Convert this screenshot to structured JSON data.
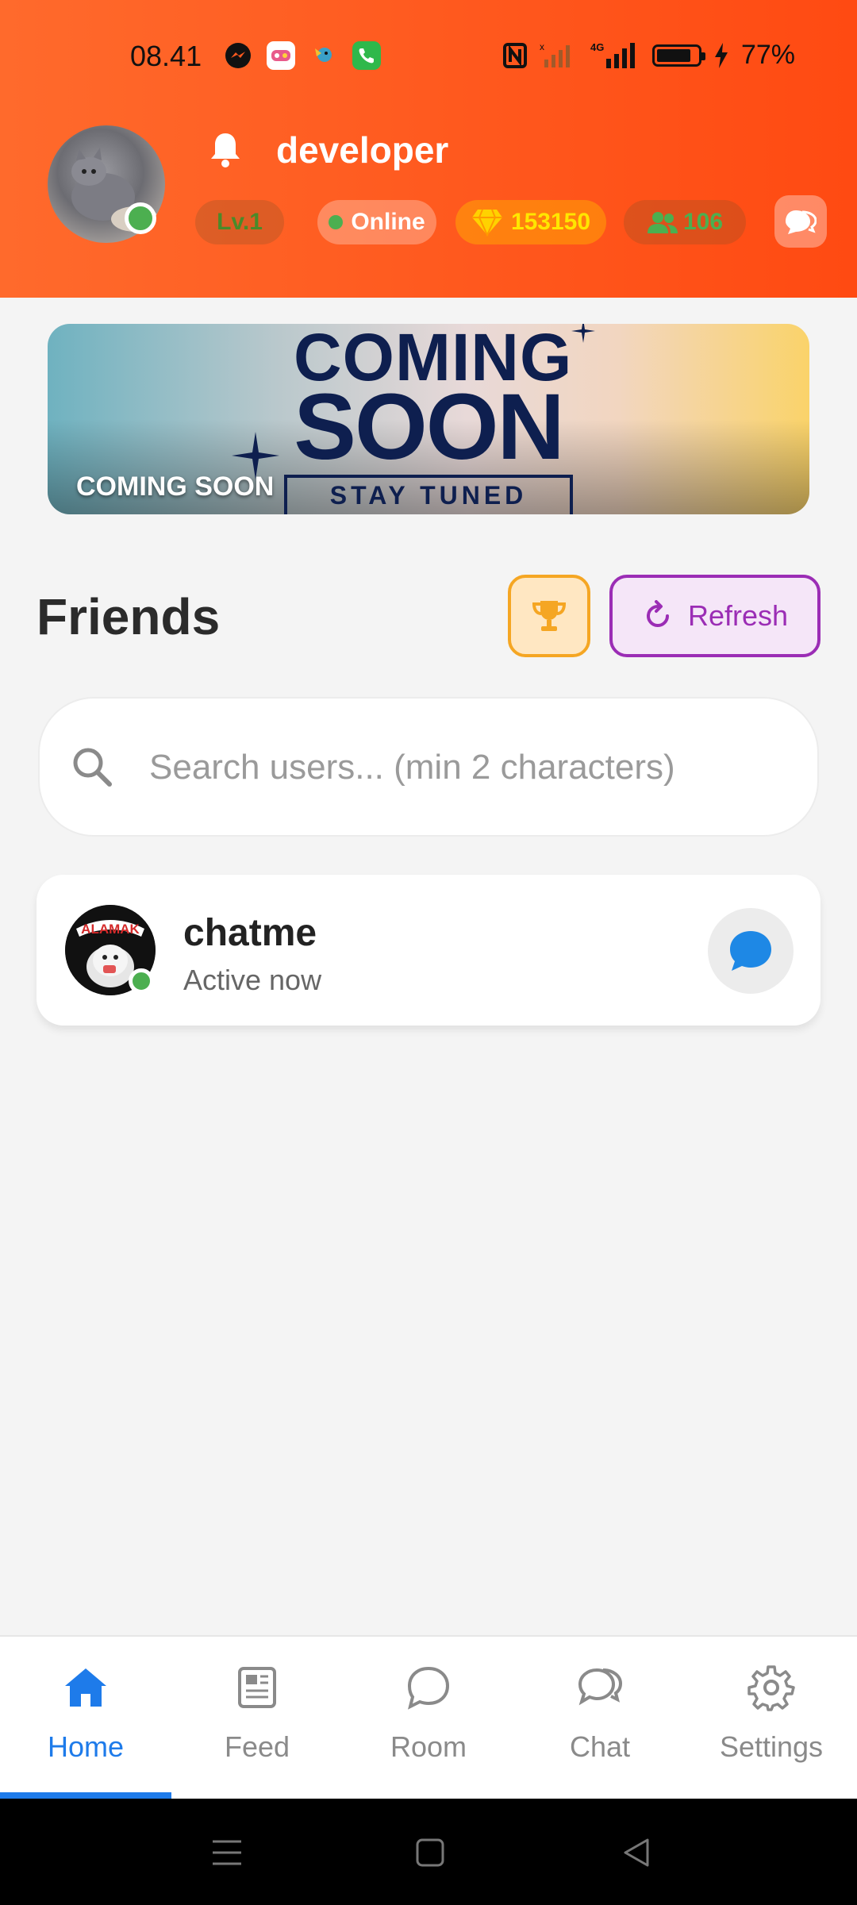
{
  "status_bar": {
    "time": "08.41",
    "battery": "77%",
    "battery_level": 0.77,
    "network": "4G",
    "notification_icons": [
      "messenger-icon",
      "game-app-icon",
      "bird-app-icon",
      "phone-app-icon"
    ]
  },
  "profile": {
    "username": "developer",
    "level": "Lv.1",
    "status": "Online",
    "coins": "153150",
    "friends_count": "106"
  },
  "banner": {
    "title_line1": "COMING",
    "title_line2": "SOON",
    "subtitle": "STAY TUNED",
    "caption": "COMING SOON"
  },
  "friends": {
    "title": "Friends",
    "refresh_label": "Refresh",
    "search_placeholder": "Search users... (min 2 characters)",
    "list": [
      {
        "name": "chatme",
        "status": "Active now",
        "avatar_text": "ALAMAK"
      }
    ]
  },
  "nav": {
    "items": [
      {
        "label": "Home",
        "icon": "home-icon",
        "active": true
      },
      {
        "label": "Feed",
        "icon": "feed-icon",
        "active": false
      },
      {
        "label": "Room",
        "icon": "room-icon",
        "active": false
      },
      {
        "label": "Chat",
        "icon": "chat-icon",
        "active": false
      },
      {
        "label": "Settings",
        "icon": "settings-icon",
        "active": false
      }
    ]
  },
  "colors": {
    "header": "#ff5a1f",
    "accent": "#1e7bea",
    "refresh": "#9b2db5",
    "trophy": "#f5a623",
    "online": "#4caf50"
  }
}
